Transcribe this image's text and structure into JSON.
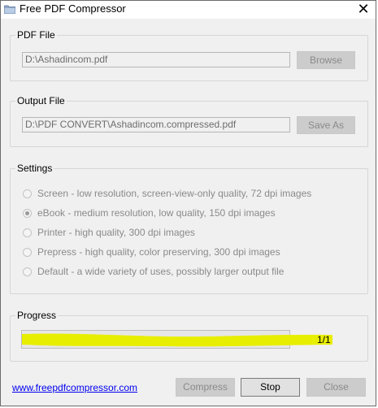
{
  "window": {
    "title": "Free PDF Compressor",
    "close_glyph": "✕"
  },
  "pdf_file": {
    "group_label": "PDF File",
    "path": "D:\\Ashadincom.pdf",
    "browse_label": "Browse"
  },
  "output_file": {
    "group_label": "Output File",
    "path": "D:\\PDF CONVERT\\Ashadincom.compressed.pdf",
    "save_as_label": "Save As"
  },
  "settings": {
    "group_label": "Settings",
    "options": [
      {
        "label": "Screen - low resolution, screen-view-only quality, 72 dpi images",
        "checked": false
      },
      {
        "label": "eBook - medium resolution, low quality, 150 dpi images",
        "checked": true
      },
      {
        "label": "Printer - high quality, 300 dpi images",
        "checked": false
      },
      {
        "label": "Prepress - high quality, color preserving, 300 dpi images",
        "checked": false
      },
      {
        "label": "Default - a wide variety of uses, possibly larger output file",
        "checked": false
      }
    ]
  },
  "progress": {
    "group_label": "Progress",
    "count": "1/1",
    "fraction": 1.0,
    "highlight_color": "#e8ee00"
  },
  "footer": {
    "website": "www.freepdfcompressor.com",
    "compress_label": "Compress",
    "stop_label": "Stop",
    "close_label": "Close"
  },
  "icons": {
    "app": "folder-icon",
    "close": "close-icon"
  }
}
